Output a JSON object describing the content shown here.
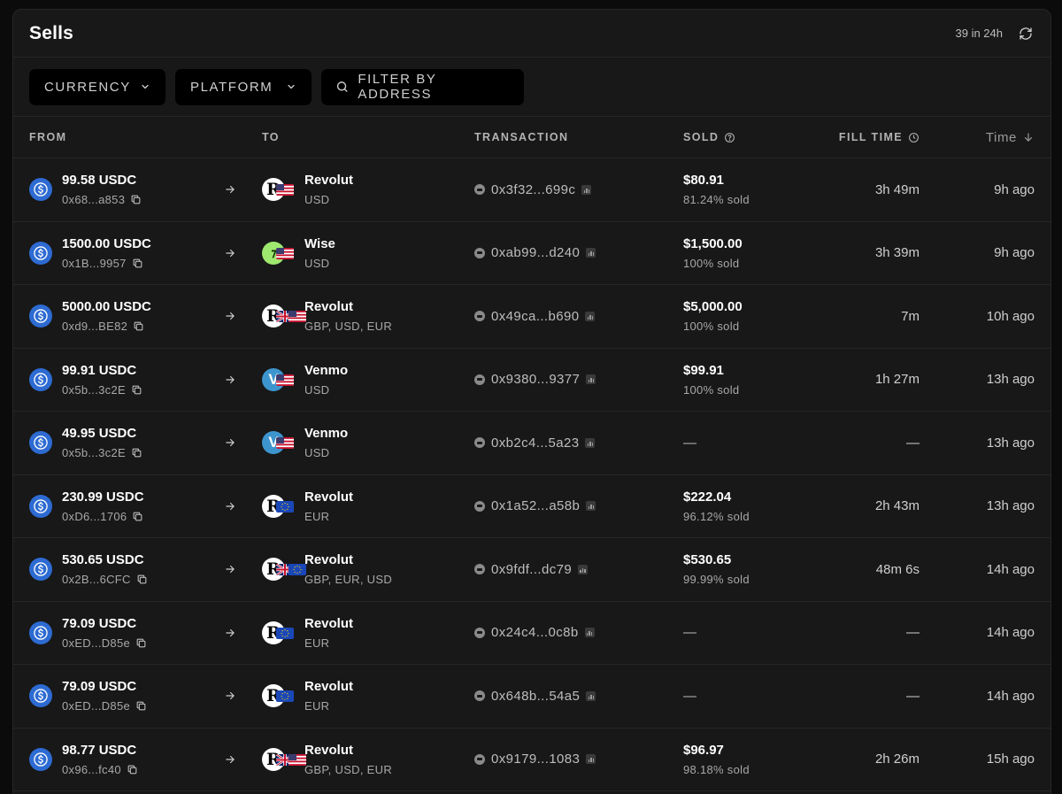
{
  "header": {
    "title": "Sells",
    "count": "39 in 24h"
  },
  "filters": {
    "currency": "CURRENCY",
    "platform": "PLATFORM",
    "search": "FILTER BY ADDRESS"
  },
  "columns": {
    "from": "FROM",
    "to": "TO",
    "transaction": "TRANSACTION",
    "sold": "SOLD",
    "fill_time": "FILL TIME",
    "time": "Time"
  },
  "colors": {
    "background": "#181818",
    "usdc": "#2d6bd2",
    "revolut": "#ffffff",
    "wise": "#9fe870",
    "venmo": "#3d95ce"
  },
  "rows": [
    {
      "amount": "99.58 USDC",
      "address": "0x68...a853",
      "platform": "Revolut",
      "logo": "revolut",
      "flags": [
        "us"
      ],
      "currencies": "USD",
      "tx": "0x3f32...699c",
      "sold_amount": "$80.91",
      "sold_pct": "81.24% sold",
      "fill": "3h 49m",
      "time": "9h ago"
    },
    {
      "amount": "1500.00 USDC",
      "address": "0x1B...9957",
      "platform": "Wise",
      "logo": "wise",
      "flags": [
        "us"
      ],
      "currencies": "USD",
      "tx": "0xab99...d240",
      "sold_amount": "$1,500.00",
      "sold_pct": "100% sold",
      "fill": "3h 39m",
      "time": "9h ago"
    },
    {
      "amount": "5000.00 USDC",
      "address": "0xd9...BE82",
      "platform": "Revolut",
      "logo": "revolut",
      "flags": [
        "gb",
        "us"
      ],
      "currencies": "GBP, USD, EUR",
      "tx": "0x49ca...b690",
      "sold_amount": "$5,000.00",
      "sold_pct": "100% sold",
      "fill": "7m",
      "time": "10h ago"
    },
    {
      "amount": "99.91 USDC",
      "address": "0x5b...3c2E",
      "platform": "Venmo",
      "logo": "venmo",
      "flags": [
        "us"
      ],
      "currencies": "USD",
      "tx": "0x9380...9377",
      "sold_amount": "$99.91",
      "sold_pct": "100% sold",
      "fill": "1h 27m",
      "time": "13h ago"
    },
    {
      "amount": "49.95 USDC",
      "address": "0x5b...3c2E",
      "platform": "Venmo",
      "logo": "venmo",
      "flags": [
        "us"
      ],
      "currencies": "USD",
      "tx": "0xb2c4...5a23",
      "sold_amount": "—",
      "sold_pct": "",
      "fill": "—",
      "time": "13h ago"
    },
    {
      "amount": "230.99 USDC",
      "address": "0xD6...1706",
      "platform": "Revolut",
      "logo": "revolut",
      "flags": [
        "eu"
      ],
      "currencies": "EUR",
      "tx": "0x1a52...a58b",
      "sold_amount": "$222.04",
      "sold_pct": "96.12% sold",
      "fill": "2h 43m",
      "time": "13h ago"
    },
    {
      "amount": "530.65 USDC",
      "address": "0x2B...6CFC",
      "platform": "Revolut",
      "logo": "revolut",
      "flags": [
        "gb",
        "eu"
      ],
      "currencies": "GBP, EUR, USD",
      "tx": "0x9fdf...dc79",
      "sold_amount": "$530.65",
      "sold_pct": "99.99% sold",
      "fill": "48m 6s",
      "time": "14h ago"
    },
    {
      "amount": "79.09 USDC",
      "address": "0xED...D85e",
      "platform": "Revolut",
      "logo": "revolut",
      "flags": [
        "eu"
      ],
      "currencies": "EUR",
      "tx": "0x24c4...0c8b",
      "sold_amount": "—",
      "sold_pct": "",
      "fill": "—",
      "time": "14h ago"
    },
    {
      "amount": "79.09 USDC",
      "address": "0xED...D85e",
      "platform": "Revolut",
      "logo": "revolut",
      "flags": [
        "eu"
      ],
      "currencies": "EUR",
      "tx": "0x648b...54a5",
      "sold_amount": "—",
      "sold_pct": "",
      "fill": "—",
      "time": "14h ago"
    },
    {
      "amount": "98.77 USDC",
      "address": "0x96...fc40",
      "platform": "Revolut",
      "logo": "revolut",
      "flags": [
        "gb",
        "us"
      ],
      "currencies": "GBP, USD, EUR",
      "tx": "0x9179...1083",
      "sold_amount": "$96.97",
      "sold_pct": "98.18% sold",
      "fill": "2h 26m",
      "time": "15h ago"
    }
  ]
}
